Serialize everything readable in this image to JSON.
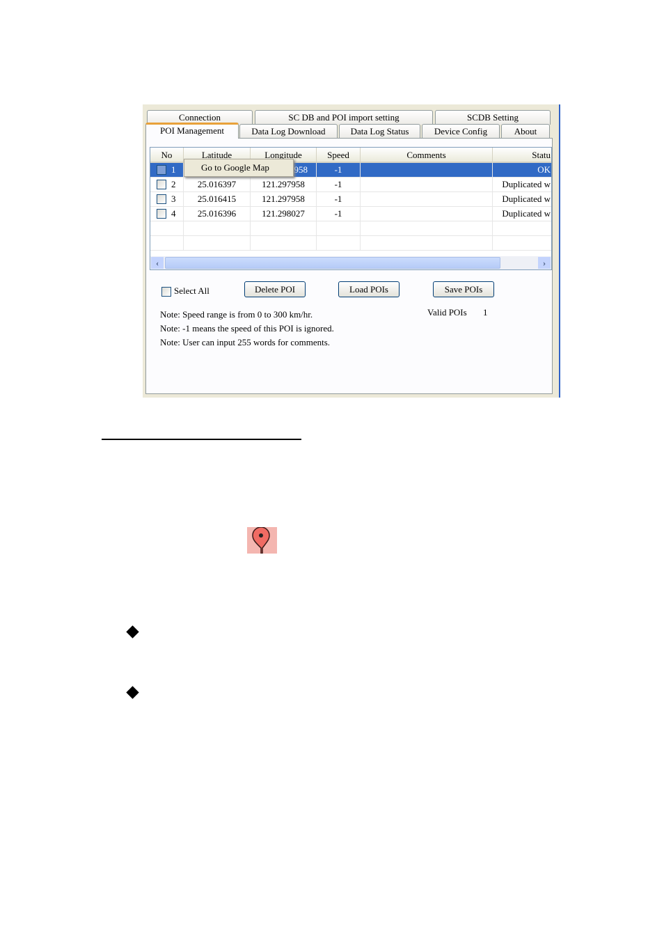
{
  "tabs_row1": [
    "Connection",
    "SC DB and POI import setting",
    "SCDB  Setting"
  ],
  "tabs_row2": [
    "POI Management",
    "Data Log Download",
    "Data Log Status",
    "Device Config",
    "About"
  ],
  "table": {
    "headers": [
      "No",
      "Latitude",
      "Longitude",
      "Speed",
      "Comments",
      "Statu"
    ],
    "rows": [
      {
        "no": "1",
        "lat": "",
        "lon": "958",
        "speed": "-1",
        "comments": "",
        "status": "OK",
        "selected": true
      },
      {
        "no": "2",
        "lat": "25.016397",
        "lon": "121.297958",
        "speed": "-1",
        "comments": "",
        "status": "Duplicated w"
      },
      {
        "no": "3",
        "lat": "25.016415",
        "lon": "121.297958",
        "speed": "-1",
        "comments": "",
        "status": "Duplicated w"
      },
      {
        "no": "4",
        "lat": "25.016396",
        "lon": "121.298027",
        "speed": "-1",
        "comments": "",
        "status": "Duplicated w"
      }
    ]
  },
  "context_menu": {
    "item": "Go to Google Map"
  },
  "controls": {
    "select_all": "Select All",
    "delete": "Delete POI",
    "load": "Load POIs",
    "save": "Save POIs",
    "valid_label": "Valid POIs",
    "valid_value": "1"
  },
  "notes": [
    "Note: Speed range is from 0 to 300 km/hr.",
    "Note: -1 means the speed of this POI is ignored.",
    "Note:  User can input 255 words for comments."
  ],
  "icons": {
    "map_pin": "map-pin-icon",
    "bullet": "diamond-bullet"
  },
  "colors": {
    "selection": "#316ac5",
    "pin": "#f06b63"
  }
}
